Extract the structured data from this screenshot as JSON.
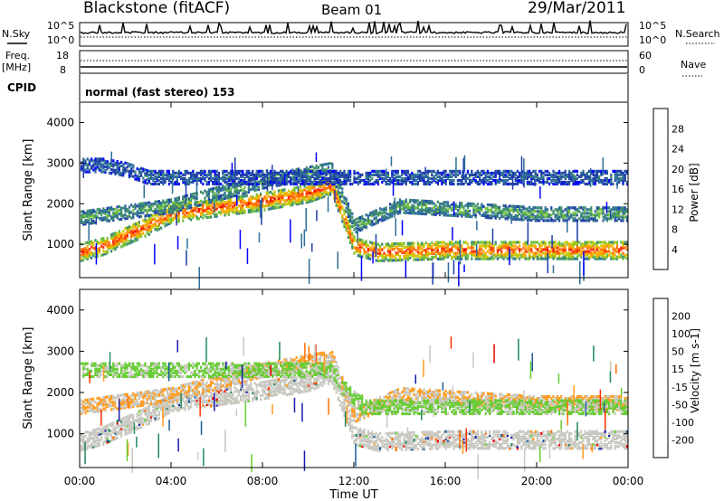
{
  "header": {
    "station": "Blackstone (fitACF)",
    "beam": "Beam 01",
    "date": "29/Mar/2011"
  },
  "top_panels": {
    "nsky_label": "N.Sky",
    "nsky_ticks": [
      "10^5",
      "10^0"
    ],
    "nsearch_label": "N.Search",
    "nsearch_ticks": [
      "10^5",
      "10^0"
    ],
    "freq_label": "Freq.",
    "freq_unit": "[MHz]",
    "freq_ticks": [
      "18",
      "8"
    ],
    "nave_label": "Nave",
    "nave_ticks": [
      "60",
      "0"
    ],
    "cpid_label": "CPID",
    "cpid_value": "normal (fast stereo) 153"
  },
  "colors": {
    "power_scale": [
      "#0000ff",
      "#1e3ea8",
      "#2e6e98",
      "#3f8f6a",
      "#6fbf3f",
      "#c8c800",
      "#ffaa00",
      "#ff7000",
      "#ff3000",
      "#ee0000"
    ],
    "velocity_scale": [
      "#1818b0",
      "#1a5a9a",
      "#1f8a5a",
      "#66cc33",
      "#c8c8c0",
      "#c8c8c0",
      "#ff9c20",
      "#ff7000",
      "#ff3000",
      "#ee0000"
    ]
  },
  "chart_data": [
    {
      "type": "heatmap",
      "panel": "power",
      "ylabel": "Slant Range [km]",
      "ylim": [
        180,
        4500
      ],
      "yticks": [
        "1000",
        "2000",
        "3000",
        "4000"
      ],
      "x_range_hours": [
        0,
        24
      ],
      "colorbar": {
        "label": "Power [dB]",
        "ticks": [
          "4",
          "8",
          "12",
          "16",
          "20",
          "24",
          "28"
        ],
        "range": [
          0,
          32
        ]
      },
      "bands": [
        {
          "x": [
            0,
            1,
            2,
            3,
            4,
            6,
            8,
            10,
            11,
            12,
            13,
            16,
            20,
            24
          ],
          "range_km": [
            850,
            1000,
            1250,
            1500,
            1800,
            1950,
            2100,
            2300,
            2500,
            1000,
            850,
            900,
            900,
            900
          ],
          "power_db": 28
        },
        {
          "x": [
            0,
            2,
            4,
            6,
            8,
            10,
            11,
            12,
            14,
            20,
            24
          ],
          "range_km": [
            1700,
            1850,
            2000,
            2300,
            2600,
            2800,
            2900,
            1500,
            2000,
            1800,
            1800
          ],
          "power_db": 12
        },
        {
          "x": [
            0,
            1,
            2,
            3
          ],
          "range_km": [
            3000,
            3000,
            2900,
            2700
          ],
          "power_db": 6
        }
      ]
    },
    {
      "type": "heatmap",
      "panel": "velocity",
      "ylabel": "Slant Range [km]",
      "ylim": [
        180,
        4500
      ],
      "yticks": [
        "1000",
        "2000",
        "3000",
        "4000"
      ],
      "xlabel": "Time UT",
      "xticks": [
        "00:00",
        "04:00",
        "08:00",
        "12:00",
        "16:00",
        "20:00",
        "00:00"
      ],
      "x_range_hours": [
        0,
        24
      ],
      "colorbar": {
        "label": "Velocity [m s-1]",
        "ticks": [
          "200",
          "100",
          "50",
          "15",
          "-15",
          "-50",
          "-100",
          "-200"
        ],
        "range": [
          -250,
          250
        ]
      },
      "bands": [
        {
          "x": [
            0,
            1,
            2,
            3,
            4,
            6,
            8,
            10,
            11,
            12,
            13,
            16,
            20,
            24
          ],
          "range_km": [
            850,
            1000,
            1250,
            1500,
            1800,
            1950,
            2100,
            2300,
            2500,
            1000,
            850,
            900,
            900,
            900
          ],
          "velocity": 0
        },
        {
          "x": [
            0,
            2,
            4,
            6,
            8,
            10,
            11,
            12,
            14,
            20,
            24
          ],
          "range_km": [
            1700,
            1850,
            2000,
            2300,
            2600,
            2800,
            2900,
            1500,
            2000,
            1800,
            1800
          ],
          "velocity": -60
        },
        {
          "x": [
            11,
            11.5,
            12,
            12.5
          ],
          "range_km": [
            2600,
            2200,
            1900,
            1700
          ],
          "velocity": 60
        }
      ]
    }
  ]
}
